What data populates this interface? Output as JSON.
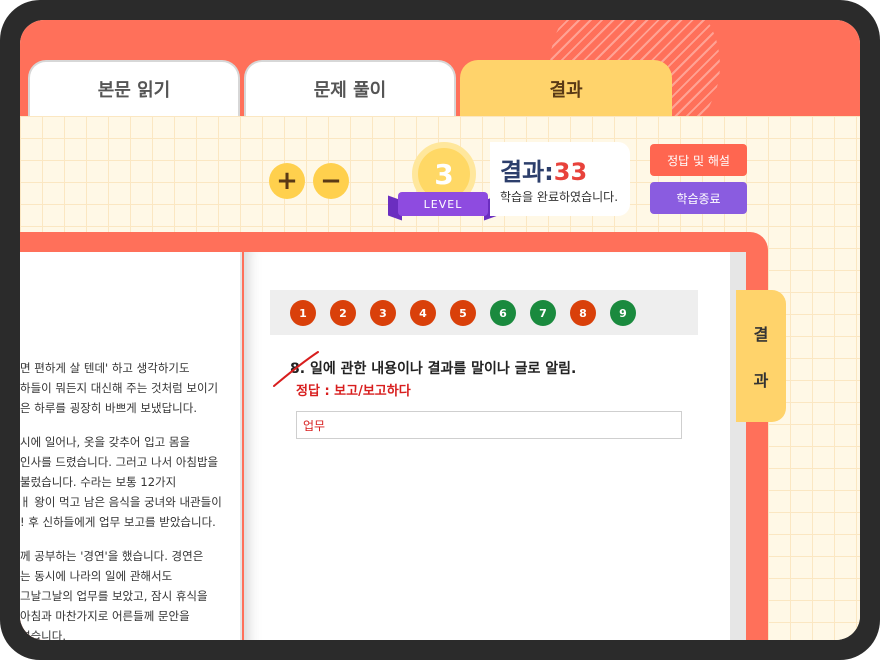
{
  "tabs": [
    {
      "label": "본문 읽기"
    },
    {
      "label": "문제 풀이"
    },
    {
      "label": "결과"
    }
  ],
  "zoom": {
    "plus": "+",
    "minus": "−"
  },
  "level": {
    "number": "3",
    "label": "LEVEL"
  },
  "score": {
    "label": "결과:",
    "value": "33",
    "desc": "학습을 완료하였습니다."
  },
  "buttons": {
    "answer": "정답 및 해설",
    "end": "학습종료"
  },
  "reading_text": [
    "면 편하게 살 텐데' 하고 생각하기도",
    "하들이 뭐든지 대신해 주는 것처럼 보이기",
    "은 하루를 굉장히 바쁘게 보냈답니다.",
    "",
    "시에 일어나, 옷을 갖추어 입고 몸을",
    "인사를 드렸습니다. 그러고 나서 아침밥을",
    "불렀습니다. 수라는 보통 12가지",
    "ㅐ 왕이 먹고 남은 음식을 궁녀와 내관들이",
    "! 후 신하들에게 업무 보고를 받았습니다.",
    "",
    "께 공부하는 '경연'을 했습니다. 경연은",
    "는 동시에 나라의 일에 관해서도",
    "그날그날의 업무를 보았고, 잠시 휴식을",
    "아침과 마찬가지로 어른들께 문안을",
    "렸습니다."
  ],
  "question_numbers": [
    {
      "num": "1",
      "color": "#d9400a"
    },
    {
      "num": "2",
      "color": "#d9400a"
    },
    {
      "num": "3",
      "color": "#d9400a"
    },
    {
      "num": "4",
      "color": "#d9400a"
    },
    {
      "num": "5",
      "color": "#d9400a"
    },
    {
      "num": "6",
      "color": "#1a8a3e"
    },
    {
      "num": "7",
      "color": "#1a8a3e"
    },
    {
      "num": "8",
      "color": "#d9400a"
    },
    {
      "num": "9",
      "color": "#1a8a3e"
    }
  ],
  "question": {
    "number": "8.",
    "text": "일에 관한 내용이나 결과를 말이나 글로 알림.",
    "correct": "정답 : 보고/보고하다",
    "user_answer": "업무"
  },
  "side_tab": {
    "line1": "결",
    "line2": "과"
  }
}
